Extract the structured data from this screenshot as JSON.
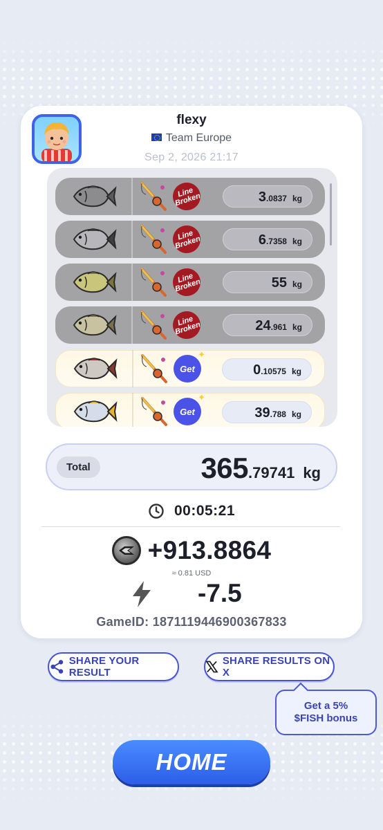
{
  "player": {
    "name": "flexy",
    "team": "Team Europe",
    "date": "Sep 2, 2026 21:17"
  },
  "catches": [
    {
      "fish": "dark-porgy-icon",
      "rod": "fishing-rod-icon",
      "status": "Line Broken",
      "status_top": "Line",
      "status_bottom": "Broken",
      "weight_int": "3",
      "weight_dec": ".0837",
      "unit": "kg"
    },
    {
      "fish": "rockfish-icon",
      "rod": "fishing-rod-icon",
      "status": "Line Broken",
      "status_top": "Line",
      "status_bottom": "Broken",
      "weight_int": "6",
      "weight_dec": ".7358",
      "unit": "kg"
    },
    {
      "fish": "bass-icon",
      "rod": "fishing-rod-icon",
      "status": "Line Broken",
      "status_top": "Line",
      "status_bottom": "Broken",
      "weight_int": "55",
      "weight_dec": "",
      "unit": "kg"
    },
    {
      "fish": "pike-icon",
      "rod": "fishing-rod-icon",
      "status": "Line Broken",
      "status_top": "Line",
      "status_bottom": "Broken",
      "weight_int": "24",
      "weight_dec": ".961",
      "unit": "kg"
    },
    {
      "fish": "catfish-icon",
      "rod": "fishing-rod-icon",
      "status": "Get",
      "status_top": "Get",
      "status_bottom": "",
      "weight_int": "0",
      "weight_dec": ".10575",
      "unit": "kg"
    },
    {
      "fish": "yellowtail-icon",
      "rod": "fishing-rod-icon",
      "status": "Get",
      "status_top": "Get",
      "status_bottom": "",
      "weight_int": "39",
      "weight_dec": ".788",
      "unit": "kg"
    }
  ],
  "total": {
    "label": "Total",
    "value_int": "365",
    "value_dec": ".79741",
    "unit": "kg"
  },
  "timer": "00:05:21",
  "reward": {
    "amount": "+913.8864",
    "usd": "≈ 0.81 USD"
  },
  "energy": "-7.5",
  "game": {
    "label": "GameID:",
    "id": "1871119446900367833"
  },
  "buttons": {
    "share_result": "SHARE YOUR RESULT",
    "share_x": "SHARE RESULTS ON X",
    "home": "HOME"
  },
  "bonus": {
    "line1": "Get a 5%",
    "line2": "$FISH bonus"
  },
  "colors": {
    "accent": "#3f63e6",
    "line_broken": "#a51a22",
    "get_badge": "#4a52e8",
    "background": "#e6ebf4"
  }
}
